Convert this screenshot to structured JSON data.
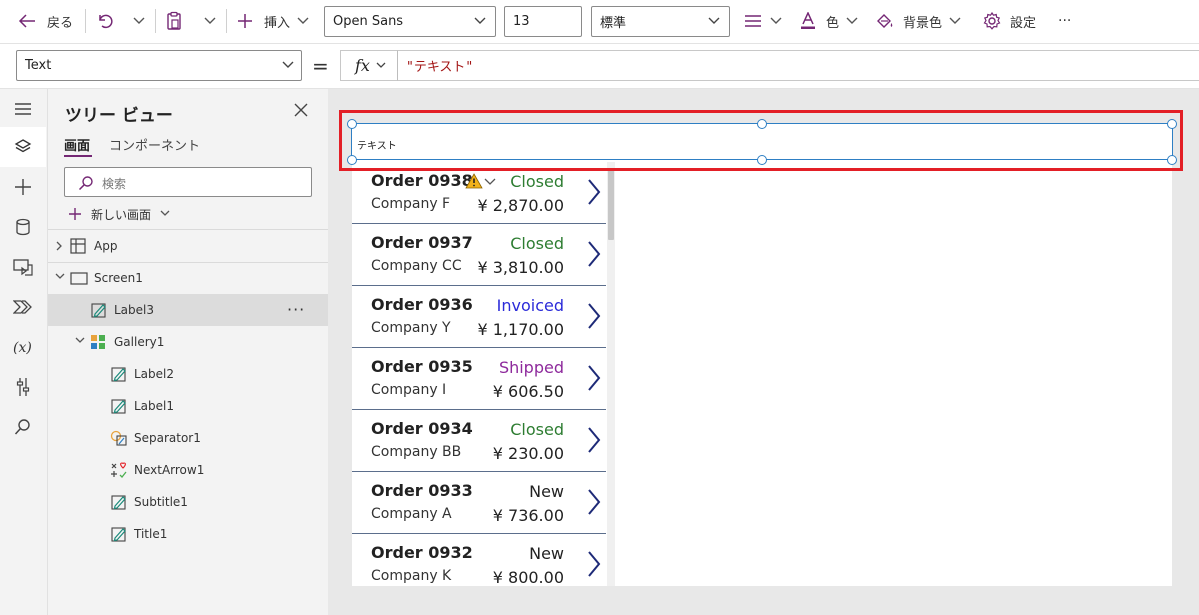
{
  "toolbar": {
    "back_label": "戻る",
    "insert_label": "挿入",
    "font_name": "Open Sans",
    "font_size": "13",
    "font_weight": "標準",
    "color_label": "色",
    "fill_label": "背景色",
    "settings_label": "設定",
    "more_label": "···"
  },
  "formula_bar": {
    "property": "Text",
    "equals": "=",
    "fx_label": "fx",
    "formula": "\"テキスト\""
  },
  "tree": {
    "title": "ツリー ビュー",
    "tabs": [
      "画面",
      "コンポーネント"
    ],
    "search_placeholder": "検索",
    "new_screen_label": "新しい画面",
    "nodes": [
      {
        "label": "App"
      },
      {
        "label": "Screen1"
      },
      {
        "label": "Label3"
      },
      {
        "label": "Gallery1"
      },
      {
        "label": "Label2"
      },
      {
        "label": "Label1"
      },
      {
        "label": "Separator1"
      },
      {
        "label": "NextArrow1"
      },
      {
        "label": "Subtitle1"
      },
      {
        "label": "Title1"
      }
    ],
    "more_label": "···"
  },
  "canvas": {
    "label3_text": "テキスト",
    "gallery": [
      {
        "title": "Order 0938",
        "company": "Company F",
        "status": "Closed",
        "amount": "¥ 2,870.00",
        "status_color": "#2e7d32",
        "warning": true
      },
      {
        "title": "Order 0937",
        "company": "Company CC",
        "status": "Closed",
        "amount": "¥ 3,810.00",
        "status_color": "#2e7d32",
        "warning": false
      },
      {
        "title": "Order 0936",
        "company": "Company Y",
        "status": "Invoiced",
        "amount": "¥ 1,170.00",
        "status_color": "#2b2bd9",
        "warning": false
      },
      {
        "title": "Order 0935",
        "company": "Company I",
        "status": "Shipped",
        "amount": "¥ 606.50",
        "status_color": "#8e2a9c",
        "warning": false
      },
      {
        "title": "Order 0934",
        "company": "Company BB",
        "status": "Closed",
        "amount": "¥ 230.00",
        "status_color": "#2e7d32",
        "warning": false
      },
      {
        "title": "Order 0933",
        "company": "Company A",
        "status": "New",
        "amount": "¥ 736.00",
        "status_color": "#222222",
        "warning": false
      },
      {
        "title": "Order 0932",
        "company": "Company K",
        "status": "New",
        "amount": "¥ 800.00",
        "status_color": "#222222",
        "warning": false
      }
    ]
  },
  "colors": {
    "accent": "#742774",
    "selection": "#2e7fc4",
    "highlight_red": "#e31f26",
    "gallery_arrow": "#1e2a78"
  }
}
